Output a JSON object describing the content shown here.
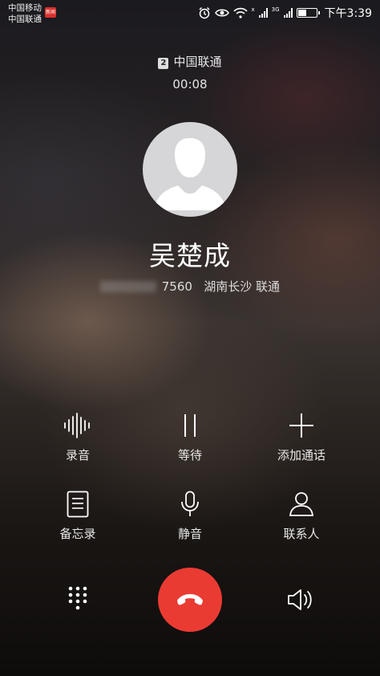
{
  "status_bar": {
    "carrier_1": "中国移动",
    "carrier_2": "中国联通",
    "hd_badge": "新闻",
    "time": "下午3:39",
    "signal_tag_1": "x",
    "signal_tag_2": "3G",
    "battery_level": 0.45,
    "icons": [
      "alarm-icon",
      "eye-icon",
      "wifi-icon",
      "signal-icon",
      "signal-icon",
      "battery-icon"
    ]
  },
  "call": {
    "sim_badge": "2",
    "carrier": "中国联通",
    "duration": "00:08",
    "contact_name": "吴楚成",
    "number_suffix": "7560",
    "location": "湖南长沙 联通"
  },
  "controls": {
    "record": "录音",
    "hold": "等待",
    "add_call": "添加通话",
    "notes": "备忘录",
    "mute": "静音",
    "contacts": "联系人"
  },
  "colors": {
    "end_call": "#ea3b33"
  }
}
